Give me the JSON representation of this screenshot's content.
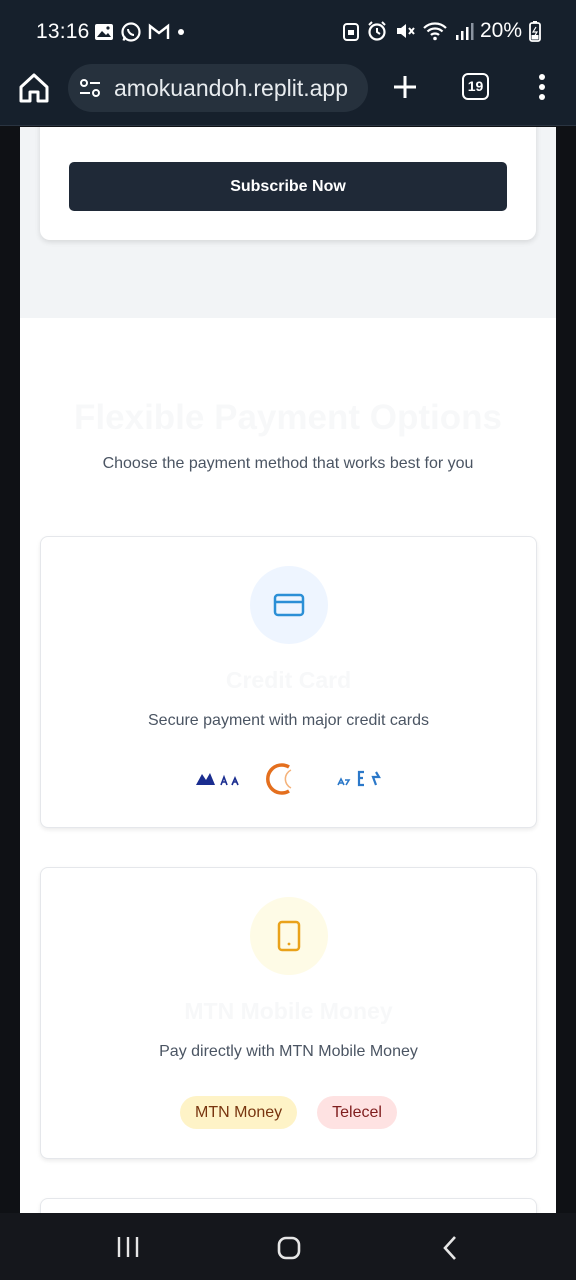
{
  "status_bar": {
    "time": "13:16",
    "battery": "20%",
    "left_icons": [
      "image-icon",
      "whatsapp-icon",
      "gmail-icon",
      "dot-icon"
    ],
    "right_icons": [
      "lock-icon",
      "alarm-icon",
      "mute-icon",
      "wifi-icon",
      "signal-icon",
      "battery-icon"
    ]
  },
  "browser": {
    "url": "amokuandoh.replit.app",
    "tab_count": "19"
  },
  "subscribe": {
    "button_label": "Subscribe Now"
  },
  "payment_section": {
    "title": "Flexible Payment Options",
    "subtitle": "Choose the payment method that works best for you",
    "methods": [
      {
        "title": "Credit Card",
        "description": "Secure payment with major credit cards",
        "icon": "credit-card-icon",
        "accent": "#2b8fd6",
        "icon_bg": "#eef5ff",
        "logos": [
          "visa-logo",
          "mastercard-logo",
          "amex-logo"
        ]
      },
      {
        "title": "MTN Mobile Money",
        "description": "Pay directly with MTN Mobile Money",
        "icon": "mobile-phone-icon",
        "accent": "#e9a21a",
        "icon_bg": "#fefbe6",
        "badges": [
          "MTN Money",
          "Telecel"
        ]
      }
    ]
  },
  "colors": {
    "status_bar_bg": "#16202c",
    "primary_button": "#1f2937",
    "badge_mtn_bg": "#fef3c7",
    "badge_telecel_bg": "#fee2e2"
  }
}
